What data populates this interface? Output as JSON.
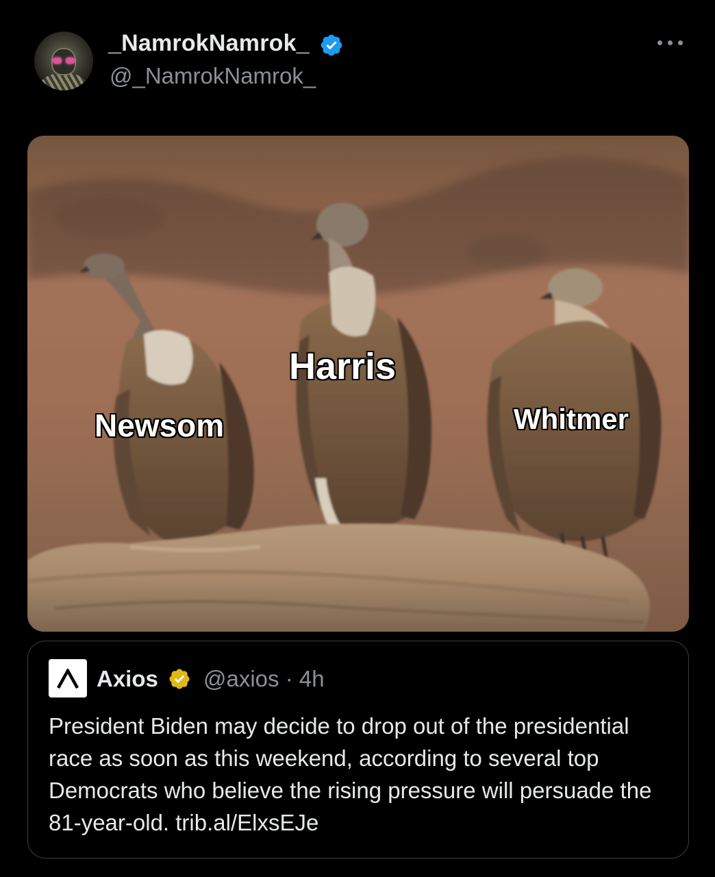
{
  "tweet": {
    "display_name": "_NamrokNamrok_",
    "handle": "@_NamrokNamrok_",
    "verified_icon": "verified-badge-blue",
    "more_icon": "more-options-icon"
  },
  "media": {
    "labels": {
      "left": "Newsom",
      "center": "Harris",
      "right": "Whitmer"
    }
  },
  "quoted": {
    "logo_icon": "axios-logo",
    "name": "Axios",
    "verified_icon": "verified-badge-gold",
    "handle_time": "@axios · 4h",
    "text": "President Biden may decide to drop out of the presidential race as soon as this weekend, according to several top Democrats who believe the rising pressure will persuade the 81-year-old. trib.al/ElxsEJe"
  },
  "colors": {
    "background": "#000000",
    "text_primary": "#e7e9ea",
    "text_secondary": "#8b9095",
    "verified_blue": "#1d9bf0",
    "verified_gold": "#e2b719",
    "border": "#3a3d40"
  }
}
